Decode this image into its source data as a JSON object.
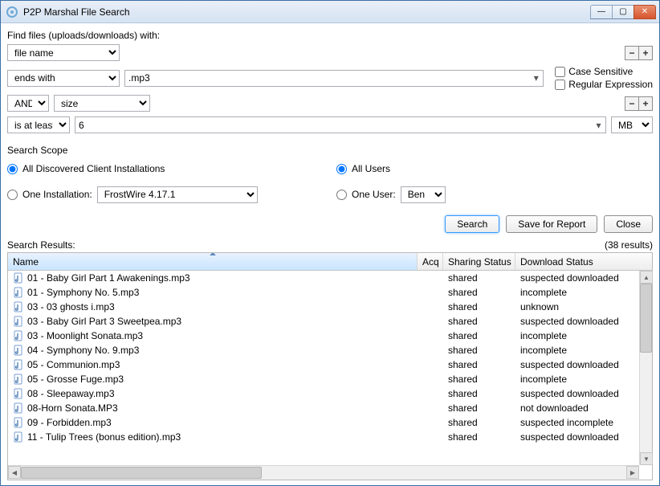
{
  "window": {
    "title": "P2P Marshal File Search"
  },
  "header_label": "Find files (uploads/downloads) with:",
  "row1": {
    "field": "file name",
    "btn_minus": "−",
    "btn_plus": "+"
  },
  "row2": {
    "op": "ends with",
    "value": ".mp3",
    "case_sensitive": "Case Sensitive",
    "regex": "Regular Expression"
  },
  "row3": {
    "join": "AND",
    "field": "size",
    "btn_minus": "−",
    "btn_plus": "+"
  },
  "row4": {
    "op": "is at least",
    "value": "6",
    "unit": "MB"
  },
  "scope": {
    "title": "Search Scope",
    "all_installs": "All Discovered Client Installations",
    "one_install": "One Installation:",
    "install_value": "FrostWire 4.17.1",
    "all_users": "All Users",
    "one_user": "One User:",
    "user_value": "Ben"
  },
  "buttons": {
    "search": "Search",
    "save": "Save for Report",
    "close": "Close"
  },
  "results": {
    "label": "Search Results:",
    "count": "(38 results)"
  },
  "columns": {
    "name": "Name",
    "acq": "Acq",
    "sharing": "Sharing Status",
    "download": "Download Status"
  },
  "rows": [
    {
      "name": "01 - Baby Girl Part 1 Awakenings.mp3",
      "sharing": "shared",
      "download": "suspected downloaded"
    },
    {
      "name": "01 - Symphony No. 5.mp3",
      "sharing": "shared",
      "download": "incomplete"
    },
    {
      "name": "03 - 03 ghosts i.mp3",
      "sharing": "shared",
      "download": "unknown"
    },
    {
      "name": "03 - Baby Girl Part 3 Sweetpea.mp3",
      "sharing": "shared",
      "download": "suspected downloaded"
    },
    {
      "name": "03 - Moonlight Sonata.mp3",
      "sharing": "shared",
      "download": "incomplete"
    },
    {
      "name": "04 - Symphony No. 9.mp3",
      "sharing": "shared",
      "download": "incomplete"
    },
    {
      "name": "05 - Communion.mp3",
      "sharing": "shared",
      "download": "suspected downloaded"
    },
    {
      "name": "05 - Grosse Fuge.mp3",
      "sharing": "shared",
      "download": "incomplete"
    },
    {
      "name": "08 - Sleepaway.mp3",
      "sharing": "shared",
      "download": "suspected downloaded"
    },
    {
      "name": "08-Horn Sonata.MP3",
      "sharing": "shared",
      "download": "not downloaded"
    },
    {
      "name": "09 - Forbidden.mp3",
      "sharing": "shared",
      "download": "suspected incomplete"
    },
    {
      "name": "11 - Tulip Trees (bonus edition).mp3",
      "sharing": "shared",
      "download": "suspected downloaded"
    }
  ]
}
